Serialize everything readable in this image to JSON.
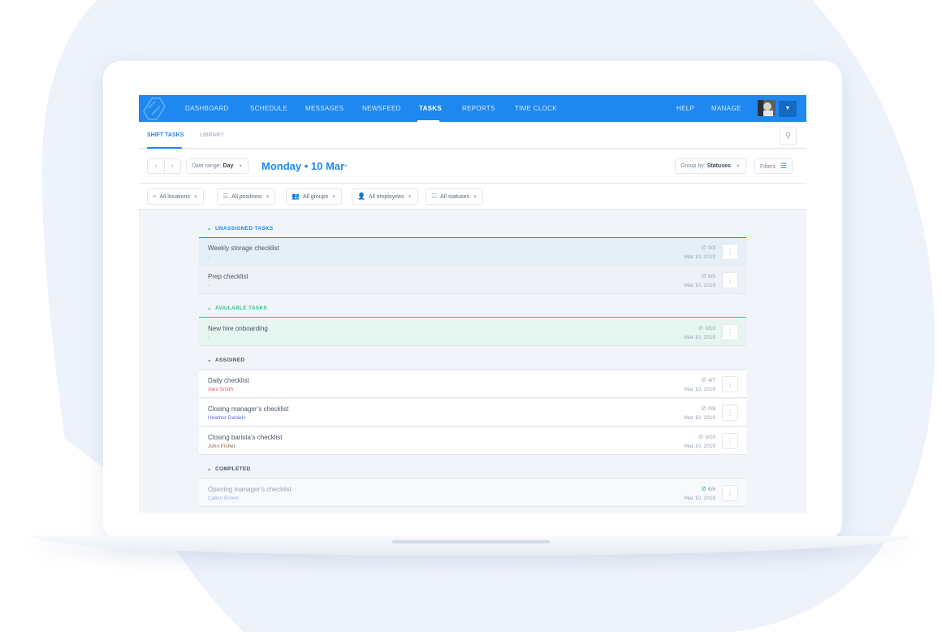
{
  "colors": {
    "brand": "#1e88f0",
    "unassigned_bg": "#e6eef8",
    "available_bg": "#e6f5f0",
    "available_accent": "#2fc48d"
  },
  "nav": {
    "items": [
      "DASHBOARD",
      "SCHEDULE",
      "MESSAGES",
      "NEWSFEED",
      "TASKS",
      "REPORTS",
      "TIME CLOCK"
    ],
    "right_items": [
      "HELP",
      "MANAGE"
    ],
    "active": "TASKS"
  },
  "subtabs": {
    "shift_tasks": "SHIFT TASKS",
    "library": "LIBRARY"
  },
  "toolbar": {
    "prev": "‹",
    "next": "›",
    "date_range_label": "Date range:",
    "date_range_value": "Day",
    "date_title": "Monday • 10 Mar",
    "group_label": "Group by:",
    "group_value": "Statuses",
    "filters_label": "Filters"
  },
  "filters": [
    "All locations",
    "All positions",
    "All groups",
    "All employees",
    "All statuses"
  ],
  "sections": {
    "unassigned": "UNASSIGNED TASKS",
    "available": "AVAILABLE TASKS",
    "assigned": "ASSGINED",
    "completed": "COMPLETED"
  },
  "tasks": [
    {
      "title": "Weekly storage checklist",
      "sub": "-",
      "progress": "0/3",
      "date": "Mar 10, 2019"
    },
    {
      "title": "Prep checklist",
      "sub": "-",
      "progress": "0/5",
      "date": "Mar 10, 2019"
    },
    {
      "title": "New hire onboarding",
      "sub": "-",
      "progress": "0/10",
      "date": "Mar 10, 2019"
    },
    {
      "title": "Daily checklist",
      "sub": "Alex Smith",
      "sub_color": "#e8556a",
      "progress": "4/7",
      "date": "Mar 10, 2019"
    },
    {
      "title": "Closing manager’s checklist",
      "sub": "Heather Daniels",
      "sub_color": "#5b6ee6",
      "progress": "0/8",
      "date": "Mar 10, 2019"
    },
    {
      "title": "Closing barista’s checklist",
      "sub": "John Fisher",
      "sub_color": "#8b6a4e",
      "progress": "0/10",
      "date": "Mar 10, 2019"
    },
    {
      "title": "Opening manager’s checklist",
      "sub": "Calvin Brown",
      "sub_color": "#7fa0d8",
      "progress": "6/6",
      "date": "Mar 10, 2019"
    }
  ]
}
